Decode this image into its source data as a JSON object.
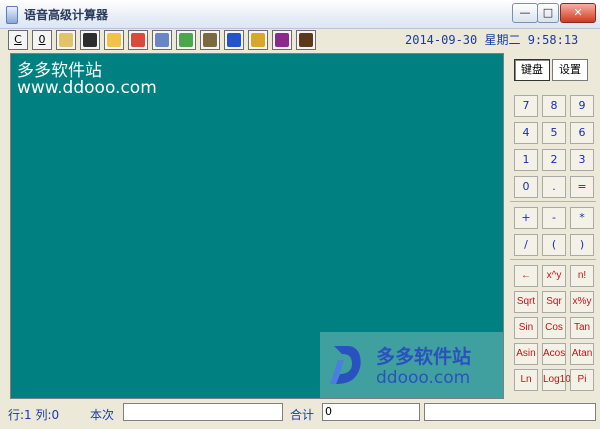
{
  "window": {
    "title": "语音高级计算器",
    "minimize": "—",
    "maximize": "□",
    "close": "✕"
  },
  "toolbar": {
    "buttons": [
      {
        "id": "c",
        "label": "C"
      },
      {
        "id": "0",
        "label": "0"
      },
      {
        "id": "copy",
        "icon": "copy-icon",
        "color": "#e2c36a"
      },
      {
        "id": "save",
        "icon": "save-icon",
        "color": "#2c2c2c"
      },
      {
        "id": "open",
        "icon": "open-folder-icon",
        "color": "#f0c24a"
      },
      {
        "id": "calendar",
        "icon": "calendar-icon",
        "color": "#d94a3a"
      },
      {
        "id": "find",
        "icon": "magnifier-icon",
        "color": "#6a86c4"
      },
      {
        "id": "home",
        "icon": "home-icon",
        "color": "#4aa84a"
      },
      {
        "id": "sound",
        "icon": "speaker-icon",
        "color": "#7a6a40"
      },
      {
        "id": "help",
        "icon": "help-icon",
        "color": "#2255cc"
      },
      {
        "id": "tools",
        "icon": "pen-icon",
        "color": "#d8a82a"
      },
      {
        "id": "exit",
        "icon": "exit-icon",
        "color": "#8a2a8a"
      },
      {
        "id": "quit",
        "icon": "door-icon",
        "color": "#5a3a1a"
      }
    ]
  },
  "datetime": "2014-09-30 星期二 9:58:13",
  "display": {
    "line1": "多多软件站",
    "line2": "www.ddooo.com"
  },
  "watermark": {
    "site_cn": "多多软件站",
    "site_url": "ddooo.com"
  },
  "panel": {
    "tabs": [
      {
        "label": "键盘"
      },
      {
        "label": "设置"
      }
    ],
    "keys_num": [
      [
        "7",
        "8",
        "9"
      ],
      [
        "4",
        "5",
        "6"
      ],
      [
        "1",
        "2",
        "3"
      ],
      [
        "0",
        ".",
        "="
      ]
    ],
    "keys_ops": [
      [
        "+",
        "-",
        "*"
      ],
      [
        "/",
        "(",
        ")"
      ]
    ],
    "keys_func": [
      [
        "←",
        "x^y",
        "n!"
      ],
      [
        "Sqrt",
        "Sqr",
        "x%y"
      ],
      [
        "Sin",
        "Cos",
        "Tan"
      ],
      [
        "Asin",
        "Acos",
        "Atan"
      ],
      [
        "Ln",
        "Log10",
        "Pi"
      ]
    ]
  },
  "status": {
    "rowcol": "行:1 列:0",
    "current_label": "本次",
    "current_value": "",
    "total_label": "合计",
    "total_value": "0",
    "extra_value": ""
  },
  "colors": {
    "display_bg": "#008080",
    "key_blue": "#1a2ab8",
    "key_red": "#c8101c",
    "status_blue": "#1a3aa8"
  }
}
